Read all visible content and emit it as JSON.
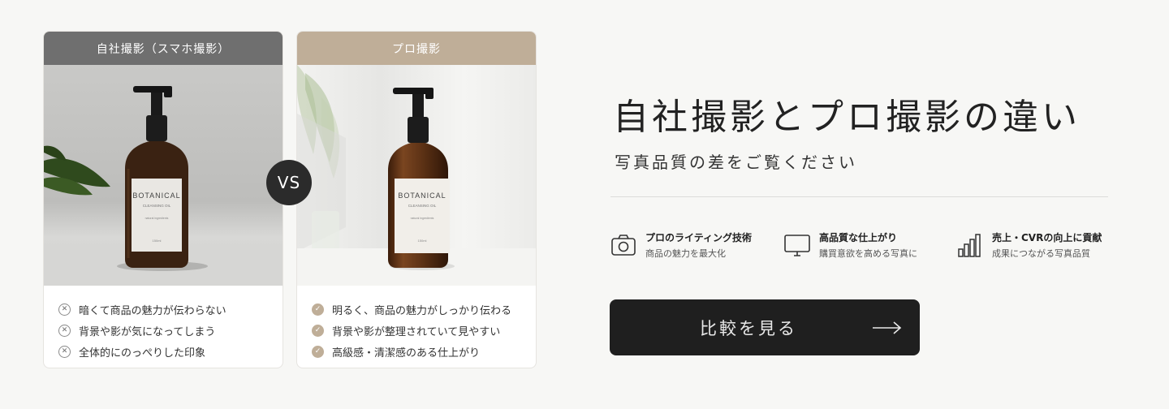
{
  "cards": {
    "self": {
      "header": "自社撮影（スマホ撮影）",
      "bottle": {
        "brand": "BOTANICAL",
        "product": "CLEANSING OIL",
        "tagline": "natural ingredients",
        "volume": "150ml"
      },
      "points": [
        "暗くて商品の魅力が伝わらない",
        "背景や影が気になってしまう",
        "全体的にのっぺりした印象"
      ]
    },
    "pro": {
      "header": "プロ撮影",
      "bottle": {
        "brand": "BOTANICAL",
        "product": "CLEANSING OIL",
        "tagline": "natural ingredients",
        "volume": "150ml"
      },
      "points": [
        "明るく、商品の魅力がしっかり伝わる",
        "背景や影が整理されていて見やすい",
        "高級感・清潔感のある仕上がり"
      ]
    }
  },
  "vs_label": "VS",
  "title": "自社撮影とプロ撮影の違い",
  "subtitle": "写真品質の差をご覧ください",
  "features": [
    {
      "icon": "camera-icon",
      "name": "プロのライティング技術",
      "desc": "商品の魅力を最大化"
    },
    {
      "icon": "monitor-icon",
      "name": "高品質な仕上がり",
      "desc": "購買意欲を高める写真に"
    },
    {
      "icon": "bar-chart-icon",
      "name": "売上・CVRの向上に貢献",
      "desc": "成果につながる写真品質"
    }
  ],
  "cta": {
    "label": "比較を見る",
    "icon": "arrow-right-icon"
  },
  "colors": {
    "accent": "#bfae98",
    "dark": "#1f1f1f",
    "self_header": "#6f6f6f",
    "bottle_amber": "#4a2a14"
  }
}
